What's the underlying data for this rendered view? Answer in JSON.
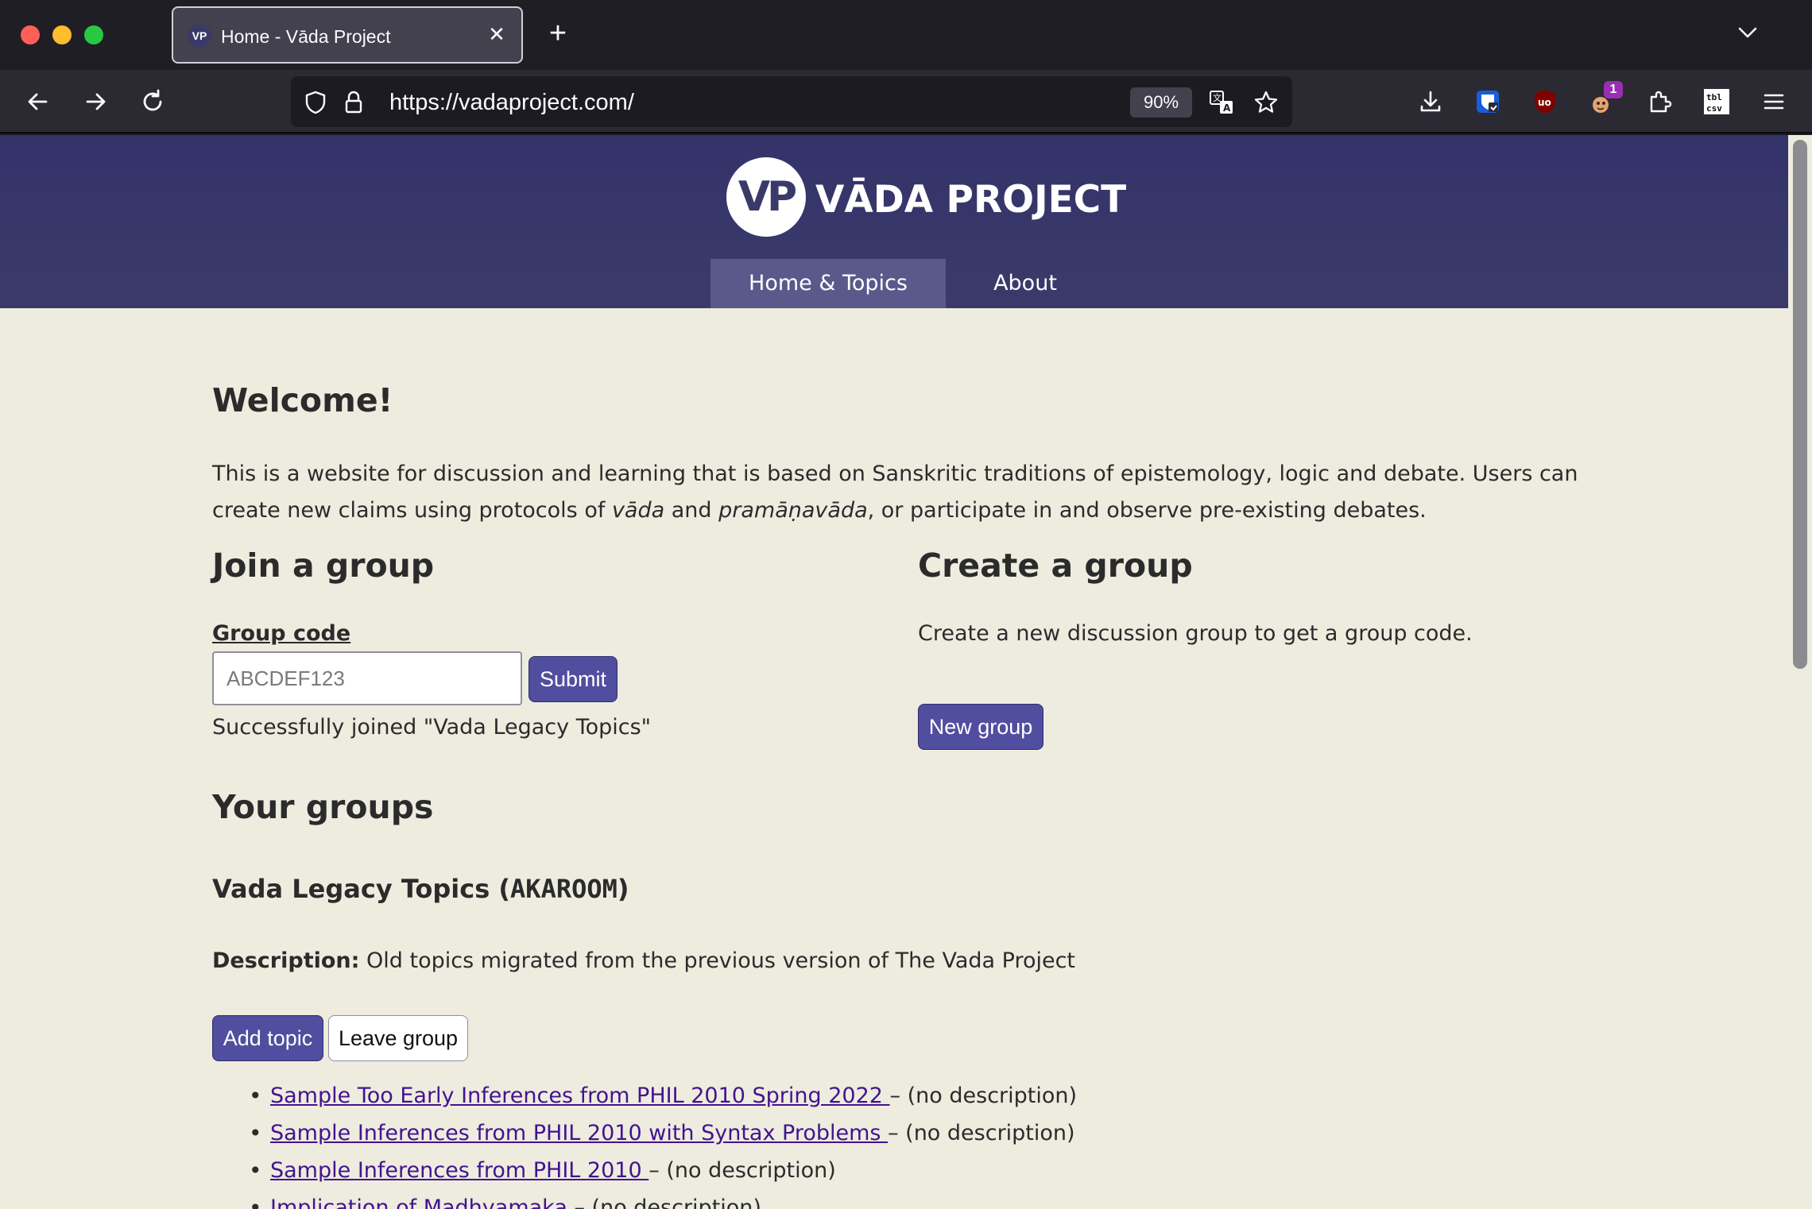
{
  "browser": {
    "tab": {
      "favicon_text": "VP",
      "title": "Home - Vāda Project",
      "close_glyph": "✕"
    },
    "new_tab_glyph": "+",
    "url": "https://vadaproject.com/",
    "zoom": "90%",
    "extension_badge": "1",
    "icons": [
      "back-icon",
      "forward-icon",
      "reload-icon",
      "shield-icon",
      "lock-icon",
      "translate-icon",
      "bookmark-star-icon",
      "download-icon",
      "bitwarden-icon",
      "ublock-icon",
      "extension-badge-icon",
      "extensions-puzzle-icon",
      "table-csv-icon",
      "menu-icon"
    ]
  },
  "site": {
    "logo_mark": "VP",
    "logo_text": "VĀDA PROJECT",
    "nav": [
      {
        "label": "Home & Topics",
        "active": true
      },
      {
        "label": "About",
        "active": false
      }
    ]
  },
  "welcome": {
    "title": "Welcome!",
    "intro_part1": "This is a website for discussion and learning that is based on Sanskritic traditions of epistemology, logic and debate. Users can create new claims using protocols of ",
    "intro_em1": "vāda",
    "intro_part2": " and ",
    "intro_em2": "pramāṇavāda",
    "intro_part3": ", or participate in and observe pre-existing debates."
  },
  "join": {
    "title": "Join a group",
    "label": "Group code",
    "placeholder": "ABCDEF123",
    "value": "",
    "submit_label": "Submit",
    "status": "Successfully joined \"Vada Legacy Topics\""
  },
  "create": {
    "title": "Create a group",
    "description": "Create a new discussion group to get a group code.",
    "button_label": "New group"
  },
  "your_groups": {
    "title": "Your groups",
    "group": {
      "name": "Vada Legacy Topics (",
      "code": "AKAROOM",
      "name_suffix": ")",
      "desc_label": "Description:",
      "desc_text": " Old topics migrated from the previous version of The Vada Project",
      "add_topic_label": "Add topic",
      "leave_label": "Leave group",
      "topics": [
        {
          "title": "Sample Too Early Inferences from PHIL 2010 Spring 2022 ",
          "sep": " – ",
          "desc": " (no description)"
        },
        {
          "title": "Sample Inferences from PHIL 2010 with Syntax Problems ",
          "sep": " – ",
          "desc": " (no description)"
        },
        {
          "title": "Sample Inferences from PHIL 2010 ",
          "sep": " – ",
          "desc": " (no description)"
        },
        {
          "title": "Implication of Madhyamaka",
          "sep": " – ",
          "desc": " (no description)"
        }
      ]
    }
  },
  "colors": {
    "header_bg": "#3b3a6a",
    "page_bg": "#edecdf",
    "accent_button": "#514ea0",
    "link": "#43138f"
  }
}
